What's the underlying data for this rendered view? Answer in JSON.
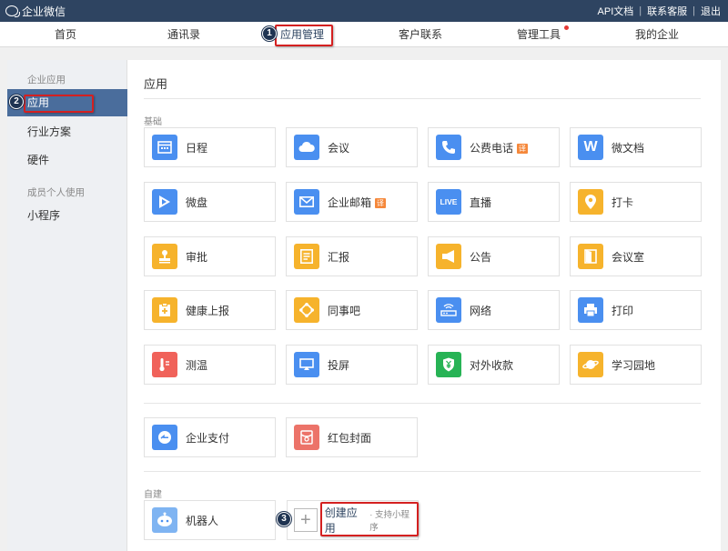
{
  "topbar": {
    "brand": "企业微信",
    "links": [
      "API文档",
      "联系客服",
      "退出"
    ]
  },
  "nav": {
    "items": [
      "首页",
      "通讯录",
      "应用管理",
      "客户联系",
      "管理工具",
      "我的企业"
    ]
  },
  "side": {
    "group1": "企业应用",
    "items1": [
      "应用",
      "行业方案",
      "硬件"
    ],
    "group2": "成员个人使用",
    "items2": [
      "小程序"
    ]
  },
  "content": {
    "title": "应用",
    "section_basic": "基础",
    "basic_apps": [
      "日程",
      "会议",
      "公费电话",
      "微文档",
      "微盘",
      "企业邮箱",
      "直播",
      "打卡",
      "审批",
      "汇报",
      "公告",
      "会议室",
      "健康上报",
      "同事吧",
      "网络",
      "打印",
      "测温",
      "投屏",
      "对外收款",
      "学习园地"
    ],
    "badge_text": "译",
    "extra_apps": [
      "企业支付",
      "红包封面"
    ],
    "section_custom": "自建",
    "custom_app": "机器人",
    "create_label": "创建应用",
    "create_sub": "· 支持小程序",
    "icon_live": "LIVE",
    "icon_w": "W"
  },
  "annotations": [
    "1",
    "2",
    "3"
  ],
  "colors": {
    "topbar": "#2e4461",
    "highlight": "#d42020",
    "blue": "#4a8ff0",
    "yellow": "#f6b32c",
    "green": "#27b355"
  }
}
